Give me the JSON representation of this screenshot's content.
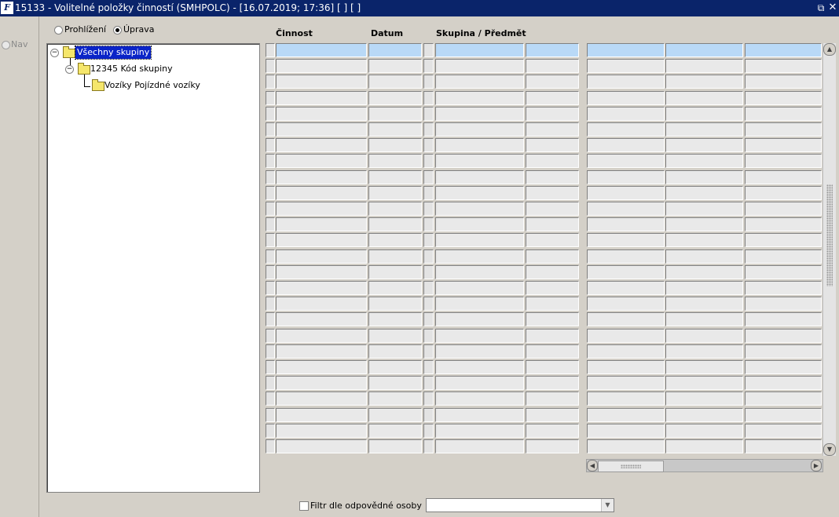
{
  "window": {
    "title": "15133 - Volitelné položky činností (SMHPOLC) - [16.07.2019; 17:36]  [ ]  [ ]",
    "logo_text": "F",
    "restore_glyph": "⧉",
    "close_glyph": "✕"
  },
  "nav": {
    "label": "Nav"
  },
  "mode": {
    "options": [
      {
        "label": "Prohlížení",
        "checked": false
      },
      {
        "label": "Úprava",
        "checked": true
      }
    ]
  },
  "tree": {
    "nodes": [
      {
        "label": "Všechny skupiny",
        "selected": true,
        "expanded": true,
        "icon": "folder-icon"
      },
      {
        "label": "12345 Kód skupiny",
        "selected": false,
        "expanded": true,
        "icon": "folder-icon"
      },
      {
        "label": "Vozíky Pojízdné vozíky",
        "selected": false,
        "expanded": false,
        "icon": "folder-icon"
      }
    ]
  },
  "grid": {
    "headers": [
      "Činnost",
      "Datum",
      "Skupina / Předmět"
    ],
    "row_count": 26
  },
  "filter": {
    "checkbox_label": "Filtr dle odpovědné osoby",
    "checked": false,
    "combo_value": ""
  },
  "colors": {
    "titlebar": "#0a246a",
    "background": "#d4d0c8",
    "selected_row": "#b9d9f7",
    "tree_selected": "#0a24c8"
  }
}
